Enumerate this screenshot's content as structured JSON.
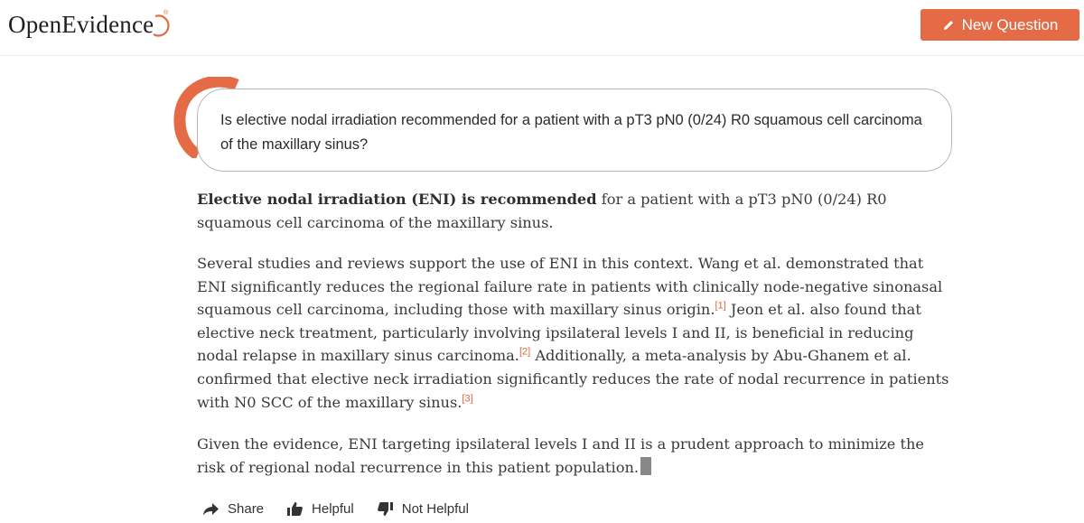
{
  "header": {
    "logo_text": "OpenEvidence",
    "logo_reg": "®",
    "new_question_label": "New Question",
    "new_question_icon": "pencil-icon"
  },
  "question": {
    "text": "Is elective nodal irradiation recommended for a patient with a pT3 pN0 (0/24) R0 squamous cell carcinoma of the maxillary sinus?"
  },
  "answer": {
    "p1_bold": "Elective nodal irradiation (ENI) is recommended",
    "p1_rest": " for a patient with a pT3 pN0 (0/24) R0 squamous cell carcinoma of the maxillary sinus.",
    "p2_s1": "Several studies and reviews support the use of ENI in this context. Wang et al. demonstrated that ENI significantly reduces the regional failure rate in patients with clinically node-negative sinonasal squamous cell carcinoma, including those with maxillary sinus origin.",
    "cite1": "[1]",
    "p2_s2": " Jeon et al. also found that elective neck treatment, particularly involving ipsilateral levels I and II, is beneficial in reducing nodal relapse in maxillary sinus carcinoma.",
    "cite2": "[2]",
    "p2_s3": " Additionally, a meta-analysis by Abu-Ghanem et al. confirmed that elective neck irradiation significantly reduces the rate of nodal recurrence in patients with N0 SCC of the maxillary sinus.",
    "cite3": "[3]",
    "p3": "Given the evidence, ENI targeting ipsilateral levels I and II is a prudent approach to minimize the risk of regional nodal recurrence in this patient population."
  },
  "actions": {
    "share_label": "Share",
    "helpful_label": "Helpful",
    "not_helpful_label": "Not Helpful"
  },
  "colors": {
    "brand": "#e46b45",
    "citation": "#e2673f"
  }
}
